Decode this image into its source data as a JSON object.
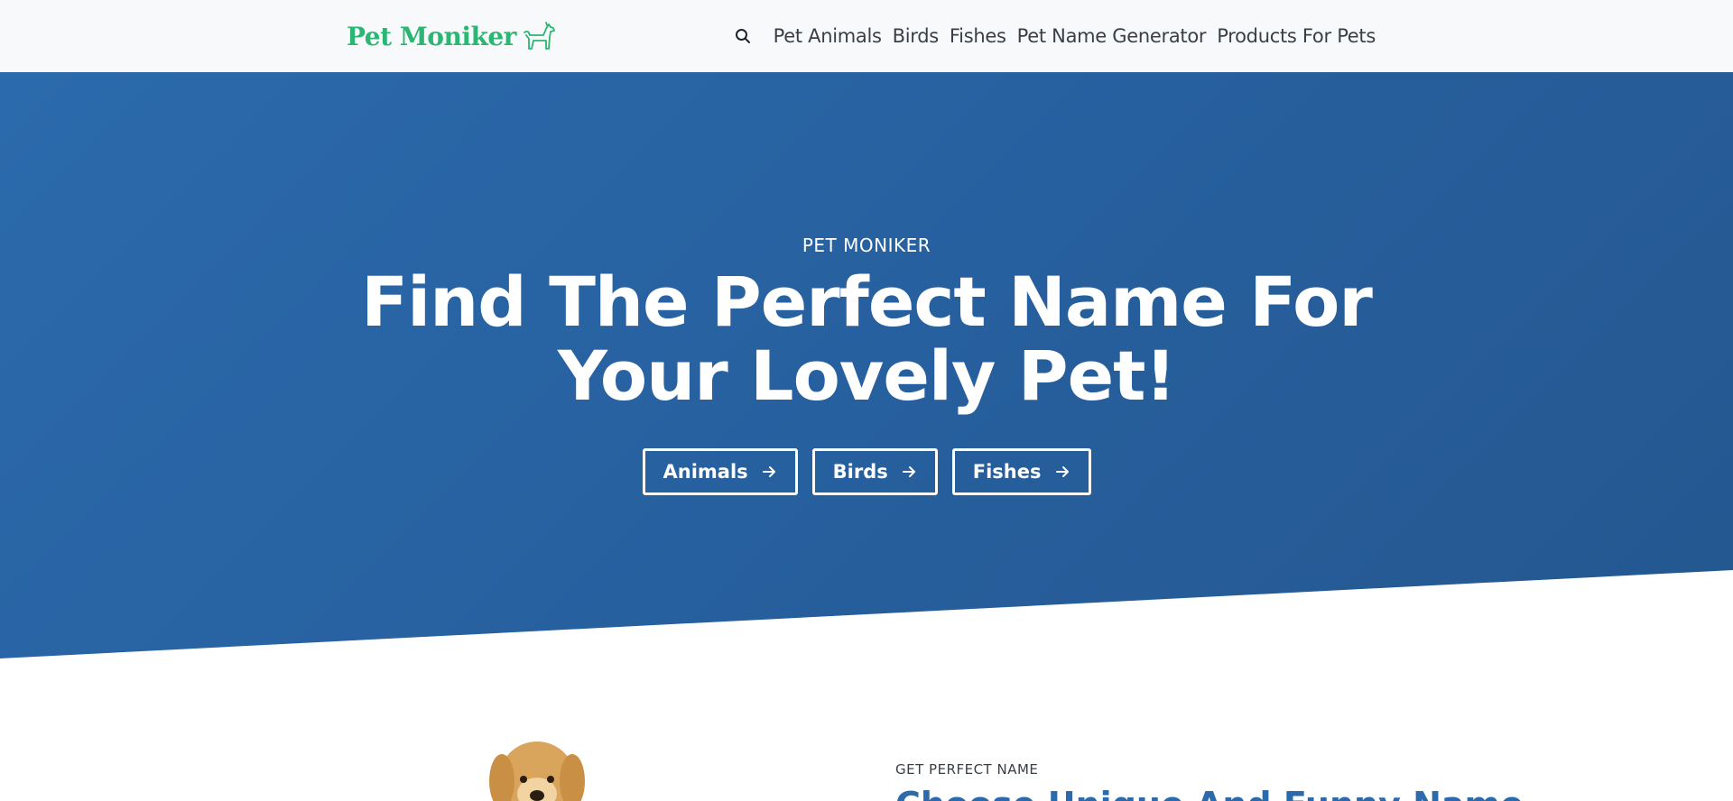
{
  "brand": {
    "name": "Pet Moniker",
    "color": "#2bb673"
  },
  "nav": {
    "items": [
      {
        "label": "Pet Animals"
      },
      {
        "label": "Birds"
      },
      {
        "label": "Fishes"
      },
      {
        "label": "Pet Name Generator"
      },
      {
        "label": "Products For Pets"
      }
    ]
  },
  "hero": {
    "eyebrow": "PET MONIKER",
    "title_line1": "Find The Perfect Name For",
    "title_line2": "Your Lovely Pet!",
    "buttons": [
      {
        "label": "Animals"
      },
      {
        "label": "Birds"
      },
      {
        "label": "Fishes"
      }
    ],
    "background_color": "#2a66a8"
  },
  "intro": {
    "eyebrow": "GET PERFECT NAME",
    "heading": "Choose Unique And Funny Name"
  }
}
